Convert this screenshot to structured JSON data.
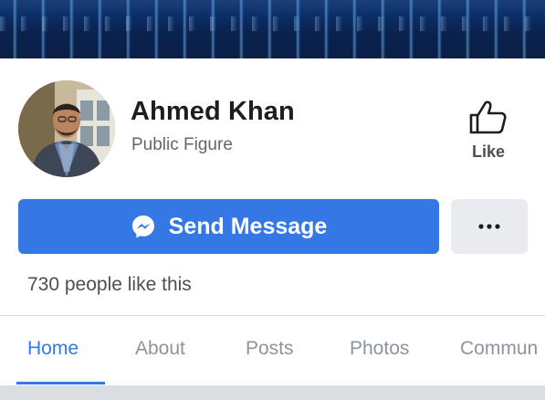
{
  "profile": {
    "name": "Ahmed Khan",
    "category": "Public Figure"
  },
  "actions": {
    "like_label": "Like",
    "send_message_label": "Send Message",
    "more_icon": "ellipsis-icon",
    "messenger_icon": "messenger-icon",
    "like_icon": "thumbs-up-icon"
  },
  "stats": {
    "likes_text": "730 people like this"
  },
  "tabs": [
    {
      "label": "Home",
      "active": true
    },
    {
      "label": "About",
      "active": false
    },
    {
      "label": "Posts",
      "active": false
    },
    {
      "label": "Photos",
      "active": false
    },
    {
      "label": "Commun",
      "active": false
    }
  ],
  "colors": {
    "accent": "#3578e5",
    "text_primary": "#1c1e21",
    "text_secondary": "#606770",
    "tab_inactive": "#8d949e",
    "button_gray": "#e9ebee"
  }
}
